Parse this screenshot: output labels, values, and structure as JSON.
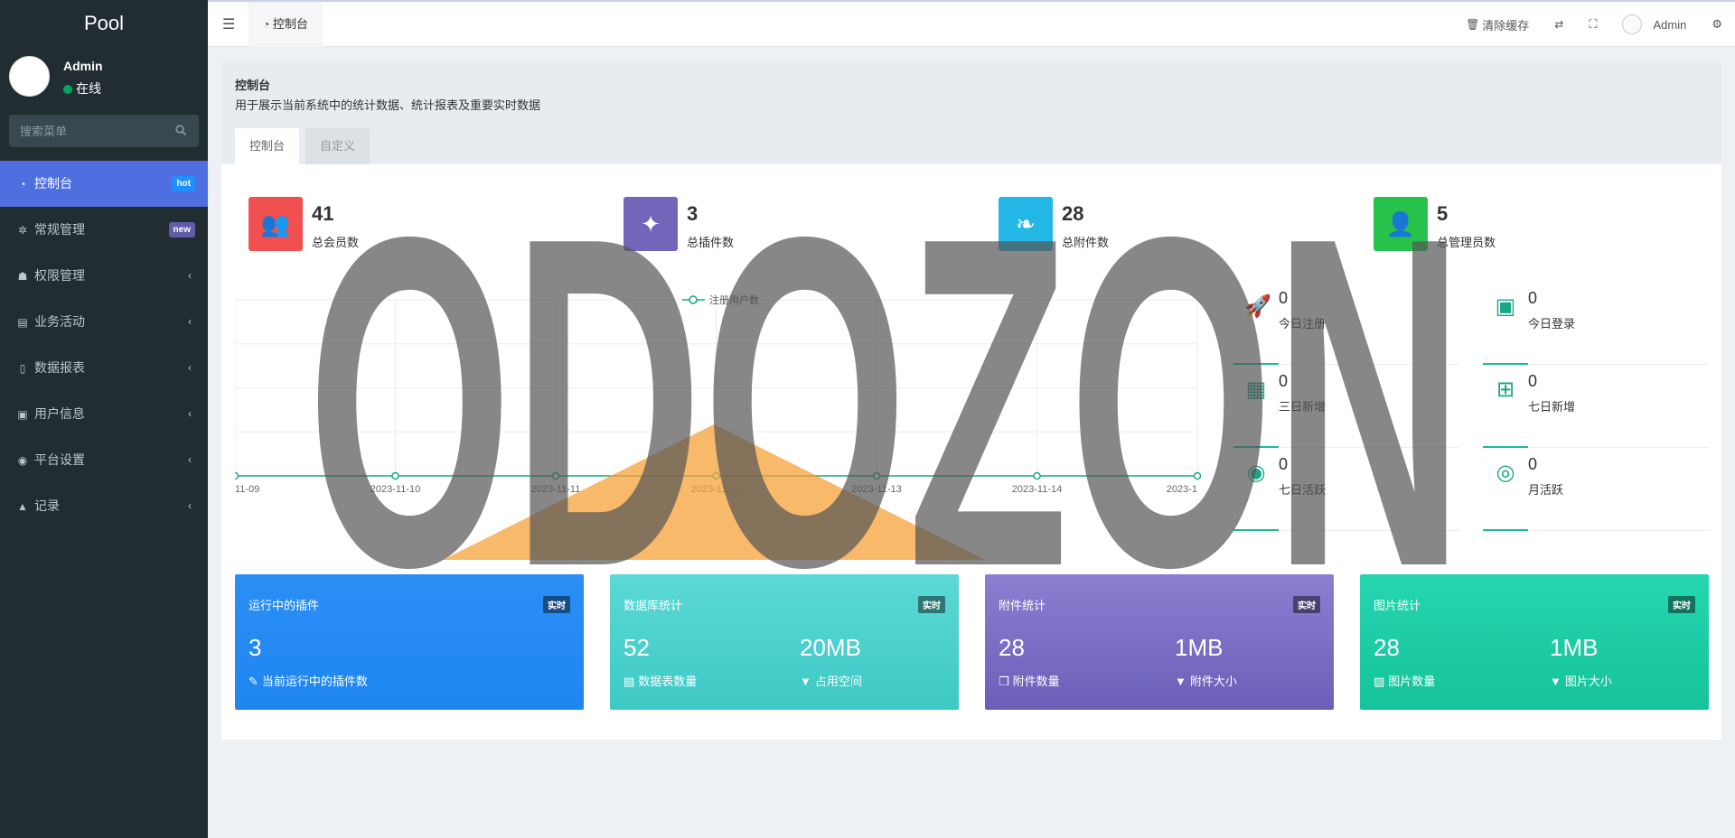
{
  "sidebar": {
    "logo": "Pool",
    "user": {
      "name": "Admin",
      "status": "在线"
    },
    "search_placeholder": "搜索菜单",
    "items": [
      {
        "label": "控制台",
        "icon": "dashboard-icon",
        "badge": "hot",
        "badge_color": "#1e90ff",
        "active": true
      },
      {
        "label": "常规管理",
        "icon": "cogs-icon",
        "badge": "new",
        "badge_color": "#605ca8"
      },
      {
        "label": "权限管理",
        "icon": "group-icon"
      },
      {
        "label": "业务活动",
        "icon": "list-alt-icon"
      },
      {
        "label": "数据报表",
        "icon": "file-icon"
      },
      {
        "label": "用户信息",
        "icon": "address-book-icon"
      },
      {
        "label": "平台设置",
        "icon": "circle-dot-icon"
      },
      {
        "label": "记录",
        "icon": "area-chart-icon"
      }
    ]
  },
  "topbar": {
    "tab_label": "控制台",
    "clear_cache": "清除缓存",
    "user": "Admin"
  },
  "page": {
    "title": "控制台",
    "description": "用于展示当前系统中的统计数据、统计报表及重要实时数据",
    "tabs": [
      "控制台",
      "自定义"
    ]
  },
  "stats": [
    {
      "value": "41",
      "label": "总会员数",
      "color": "#f05050"
    },
    {
      "value": "3",
      "label": "总插件数",
      "color": "#7266ba"
    },
    {
      "value": "28",
      "label": "总附件数",
      "color": "#23b7e5"
    },
    {
      "value": "5",
      "label": "总管理员数",
      "color": "#27c24c"
    }
  ],
  "chart_data": {
    "type": "line",
    "categories": [
      "11-09",
      "2023-11-10",
      "2023-11-11",
      "2023-11-12",
      "2023-11-13",
      "2023-11-14",
      "2023-1"
    ],
    "series": [
      {
        "name": "注册用户数",
        "values": [
          0,
          0,
          0,
          0,
          0,
          0,
          0
        ]
      }
    ],
    "grid": true,
    "legend": "top-center"
  },
  "mini_stats": [
    {
      "value": "0",
      "label": "今日注册",
      "icon": "rocket-icon"
    },
    {
      "value": "0",
      "label": "今日登录",
      "icon": "vcard-icon"
    },
    {
      "value": "0",
      "label": "三日新增",
      "icon": "calendar-icon"
    },
    {
      "value": "0",
      "label": "七日新增",
      "icon": "calendar-plus-icon"
    },
    {
      "value": "0",
      "label": "七日活跃",
      "icon": "user-circle-icon"
    },
    {
      "value": "0",
      "label": "月活跃",
      "icon": "user-circle-o-icon"
    }
  ],
  "cards": [
    {
      "title": "运行中的插件",
      "badge": "实时",
      "items": [
        {
          "value": "3",
          "label": "当前运行中的插件数"
        }
      ],
      "colors": [
        "#2a8ef5",
        "#1f86f0"
      ]
    },
    {
      "title": "数据库统计",
      "badge": "实时",
      "items": [
        {
          "value": "52",
          "label": "数据表数量"
        },
        {
          "value": "20MB",
          "label": "占用空间"
        }
      ],
      "colors": [
        "#5bd9d6",
        "#3ec9c5"
      ]
    },
    {
      "title": "附件统计",
      "badge": "实时",
      "items": [
        {
          "value": "28",
          "label": "附件数量"
        },
        {
          "value": "1MB",
          "label": "附件大小"
        }
      ],
      "colors": [
        "#8a7fd0",
        "#6b5fb8"
      ]
    },
    {
      "title": "图片统计",
      "badge": "实时",
      "items": [
        {
          "value": "28",
          "label": "图片数量"
        },
        {
          "value": "1MB",
          "label": "图片大小"
        }
      ],
      "colors": [
        "#25d6b0",
        "#16c39a"
      ]
    }
  ],
  "watermark": {
    "text": "ODOZON"
  }
}
